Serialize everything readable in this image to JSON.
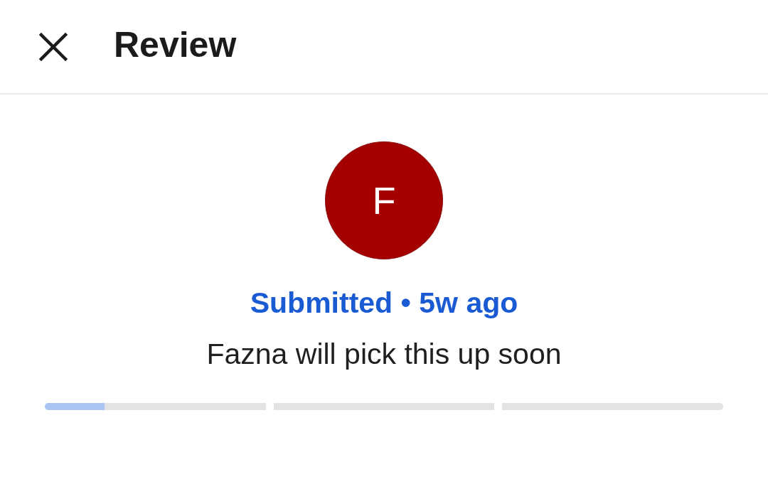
{
  "header": {
    "title": "Review"
  },
  "avatar": {
    "initial": "F"
  },
  "status": "Submitted • 5w ago",
  "message": "Fazna will pick this up soon",
  "progress": [
    {
      "level": 0.27
    },
    {
      "level": 0
    },
    {
      "level": 0
    }
  ]
}
